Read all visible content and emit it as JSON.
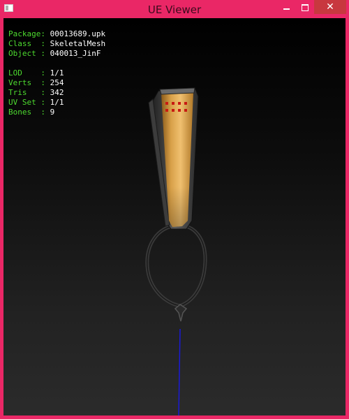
{
  "window": {
    "title": "UE Viewer",
    "close_label": "✕"
  },
  "info": {
    "package_label": "Package:",
    "package_value": "00013689.upk",
    "class_label": "Class  :",
    "class_value": "SkeletalMesh",
    "object_label": "Object :",
    "object_value": "040013_JinF",
    "lod_label": "LOD    :",
    "lod_value": "1/1",
    "verts_label": "Verts  :",
    "verts_value": "254",
    "tris_label": "Tris   :",
    "tris_value": "342",
    "uvset_label": "UV Set :",
    "uvset_value": "1/1",
    "bones_label": "Bones  :",
    "bones_value": "9"
  },
  "colors": {
    "window_frame": "#ea2766",
    "close_button": "#c8383f",
    "label_green": "#4ddb2f",
    "value_white": "#ffffff",
    "bone_line": "#1a1ad8"
  },
  "icons": {
    "app": "app-window-icon",
    "minimize": "minimize-icon",
    "maximize": "maximize-icon",
    "close": "close-icon"
  }
}
